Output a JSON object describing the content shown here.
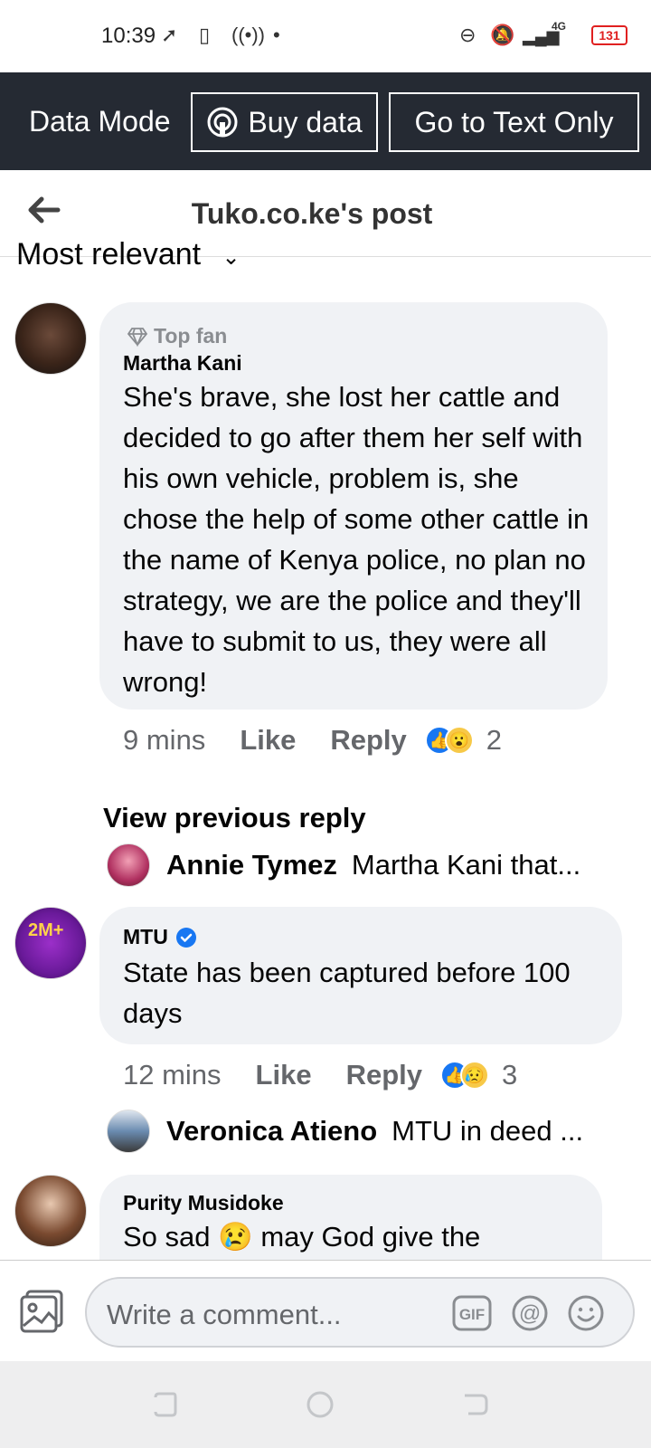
{
  "status_bar": {
    "time": "10:39",
    "network": "4G",
    "battery": "131"
  },
  "data_bar": {
    "mode_label": "Data Mode",
    "buy_label": "Buy data",
    "text_only_label": "Go to Text Only"
  },
  "header": {
    "title": "Tuko.co.ke's post"
  },
  "sort": {
    "label": "Most relevant"
  },
  "comments": [
    {
      "badge": "Top fan",
      "name": "Martha Kani",
      "text": "She's brave, she lost her cattle and decided to go after them her self with his own vehicle, problem is, she chose the help of some other cattle in the name of Kenya police, no plan no strategy, we are the police and they'll have to submit to us, they were all wrong!",
      "time": "9 mins",
      "like": "Like",
      "reply": "Reply",
      "reaction_count": "2"
    },
    {
      "name": "MTU",
      "text": "State has been captured before 100 days",
      "time": "12 mins",
      "like": "Like",
      "reply": "Reply",
      "reaction_count": "3"
    },
    {
      "name": "Purity Musidoke",
      "text": "So sad 😢 may God give the"
    }
  ],
  "view_previous": "View previous reply",
  "replies": [
    {
      "name": "Annie Tymez",
      "text": "Martha Kani that..."
    },
    {
      "name": "Veronica Atieno",
      "text": "MTU in deed ..."
    }
  ],
  "composer": {
    "placeholder": "Write a comment..."
  },
  "colors": {
    "data_bar": "#252a33",
    "bubble": "#f0f2f5",
    "like_blue": "#1877f2",
    "muted": "#65676b"
  }
}
